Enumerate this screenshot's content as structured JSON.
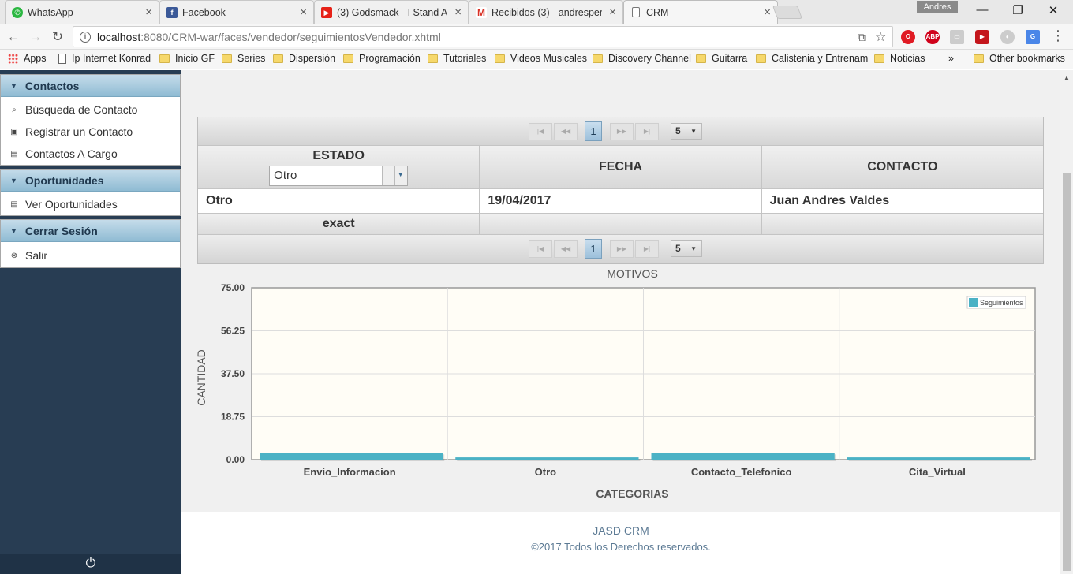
{
  "browser": {
    "tabs": [
      {
        "title": "WhatsApp",
        "favicon": "whatsapp-icon",
        "color": "#2bb741"
      },
      {
        "title": "Facebook",
        "favicon": "facebook-icon",
        "color": "#3b5998"
      },
      {
        "title": "(3) Godsmack - I Stand A",
        "favicon": "youtube-icon",
        "color": "#e62117"
      },
      {
        "title": "Recibidos (3) - andresper",
        "favicon": "gmail-icon",
        "color": "#d93025"
      },
      {
        "title": "CRM",
        "favicon": "document-icon",
        "color": "#ffffff"
      }
    ],
    "profile_name": "Andres",
    "url_host": "localhost",
    "url_path": ":8080/CRM-war/faces/vendedor/seguimientosVendedor.xhtml",
    "bookmarks": [
      {
        "label": "Apps",
        "kind": "apps"
      },
      {
        "label": "Ip Internet Konrad",
        "kind": "page"
      },
      {
        "label": "Inicio GF",
        "kind": "folder"
      },
      {
        "label": "Series",
        "kind": "folder"
      },
      {
        "label": "Dispersión",
        "kind": "folder"
      },
      {
        "label": "Programación",
        "kind": "folder"
      },
      {
        "label": "Tutoriales",
        "kind": "folder"
      },
      {
        "label": "Videos Musicales",
        "kind": "folder"
      },
      {
        "label": "Discovery Channel",
        "kind": "folder"
      },
      {
        "label": "Guitarra",
        "kind": "folder"
      },
      {
        "label": "Calistenia y Entrenam",
        "kind": "folder"
      },
      {
        "label": "Noticias",
        "kind": "folder"
      }
    ],
    "bookmarks_more": "»",
    "other_bookmarks": "Other bookmarks"
  },
  "sidebar": {
    "contactos": {
      "header": "Contactos",
      "items": [
        "Búsqueda de Contacto",
        "Registrar un Contacto",
        "Contactos A Cargo"
      ]
    },
    "oportunidades": {
      "header": "Oportunidades",
      "items": [
        "Ver Oportunidades"
      ]
    },
    "sesion": {
      "header": "Cerrar Sesión",
      "items": [
        "Salir"
      ]
    }
  },
  "table": {
    "page": "1",
    "rows_per_page": "5",
    "columns": [
      "ESTADO",
      "FECHA",
      "CONTACTO"
    ],
    "estado_filter": "Otro",
    "rows": [
      [
        "Otro",
        "19/04/2017",
        "Juan Andres Valdes"
      ]
    ],
    "footer": [
      "exact",
      "",
      ""
    ]
  },
  "chart_data": {
    "type": "bar",
    "title": "MOTIVOS",
    "xlabel": "CATEGORIAS",
    "ylabel": "CANTIDAD",
    "categories": [
      "Envio_Informacion",
      "Otro",
      "Contacto_Telefonico",
      "Cita_Virtual"
    ],
    "series": [
      {
        "name": "Seguimientos",
        "values": [
          3,
          1,
          3,
          1
        ],
        "color": "#4bb2c5"
      }
    ],
    "ylim": [
      0,
      75
    ],
    "yticks": [
      "0.00",
      "18.75",
      "37.50",
      "56.25",
      "75.00"
    ],
    "grid": true,
    "legend": "top-right"
  },
  "footer": {
    "brand": "JASD CRM",
    "copyright": "©2017 Todos los Derechos reservados."
  }
}
